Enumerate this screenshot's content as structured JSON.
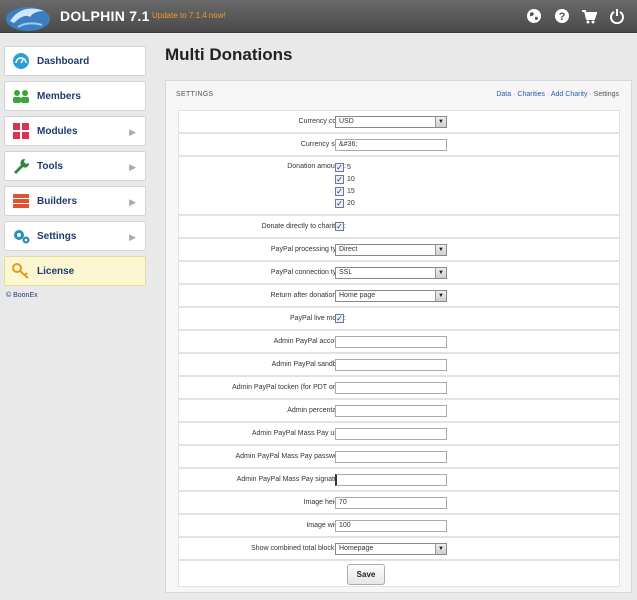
{
  "header": {
    "brand": "DOLPHIN 7.1",
    "update_link": "Update to 7.1.4 now!",
    "icons": [
      "globe-icon",
      "help-icon",
      "cart-icon",
      "power-icon"
    ]
  },
  "sidebar": {
    "items": [
      {
        "label": "Dashboard",
        "icon": "gauge-icon",
        "color": "#2a9fd6",
        "chevron": false
      },
      {
        "label": "Members",
        "icon": "members-icon",
        "color": "#3aa63a",
        "chevron": false
      },
      {
        "label": "Modules",
        "icon": "modules-icon",
        "color": "#d9344f",
        "chevron": true
      },
      {
        "label": "Tools",
        "icon": "wrench-icon",
        "color": "#2d8a3a",
        "chevron": true
      },
      {
        "label": "Builders",
        "icon": "builders-icon",
        "color": "#e2532d",
        "chevron": true
      },
      {
        "label": "Settings",
        "icon": "gears-icon",
        "color": "#2b8fb4",
        "chevron": true
      },
      {
        "label": "License",
        "icon": "key-icon",
        "color": "#e59a1a",
        "chevron": false
      }
    ],
    "copyright": "© BoonEx"
  },
  "main": {
    "title": "Multi Donations",
    "panel_title": "SETTINGS",
    "breadcrumbs": {
      "data": "Data",
      "charities": "Charities",
      "add_charity": "Add Charity",
      "settings": "Settings",
      "sep": "·"
    }
  },
  "form": {
    "currency_code": {
      "label": "Currency code:",
      "value": "USD"
    },
    "currency_sign": {
      "label": "Currency sign:",
      "value": "&#36;"
    },
    "donation_amounts": {
      "label": "Donation amounts:",
      "options": [
        "5",
        "10",
        "15",
        "20"
      ]
    },
    "donate_directly": {
      "label": "Donate directly to charities:"
    },
    "paypal_processing": {
      "label": "PayPal processing type:",
      "value": "Direct"
    },
    "paypal_connection": {
      "label": "PayPal connection type:",
      "value": "SSL"
    },
    "return_after": {
      "label": "Return after donation to:",
      "value": "Home page"
    },
    "paypal_live": {
      "label": "PayPal live mode:"
    },
    "admin_account": {
      "label": "Admin PayPal account:",
      "value": ""
    },
    "admin_sandbox": {
      "label": "Admin PayPal sandbox:",
      "value": ""
    },
    "admin_token": {
      "label": "Admin PayPal tocken (for PDT only):",
      "value": ""
    },
    "admin_percentage": {
      "label": "Admin percentage:",
      "value": ""
    },
    "mass_user": {
      "label": "Admin PayPal Mass Pay user:",
      "value": ""
    },
    "mass_password": {
      "label": "Admin PayPal Mass Pay password:",
      "value": ""
    },
    "mass_signature": {
      "label": "Admin PayPal Mass Pay signature:",
      "value": ""
    },
    "image_height": {
      "label": "Image height:",
      "value": "70"
    },
    "image_width": {
      "label": "Image width:",
      "value": "100"
    },
    "combined_block": {
      "label": "Show combined total block on:",
      "value": "Homepage"
    },
    "checkmark": "✓",
    "save_label": "Save"
  }
}
